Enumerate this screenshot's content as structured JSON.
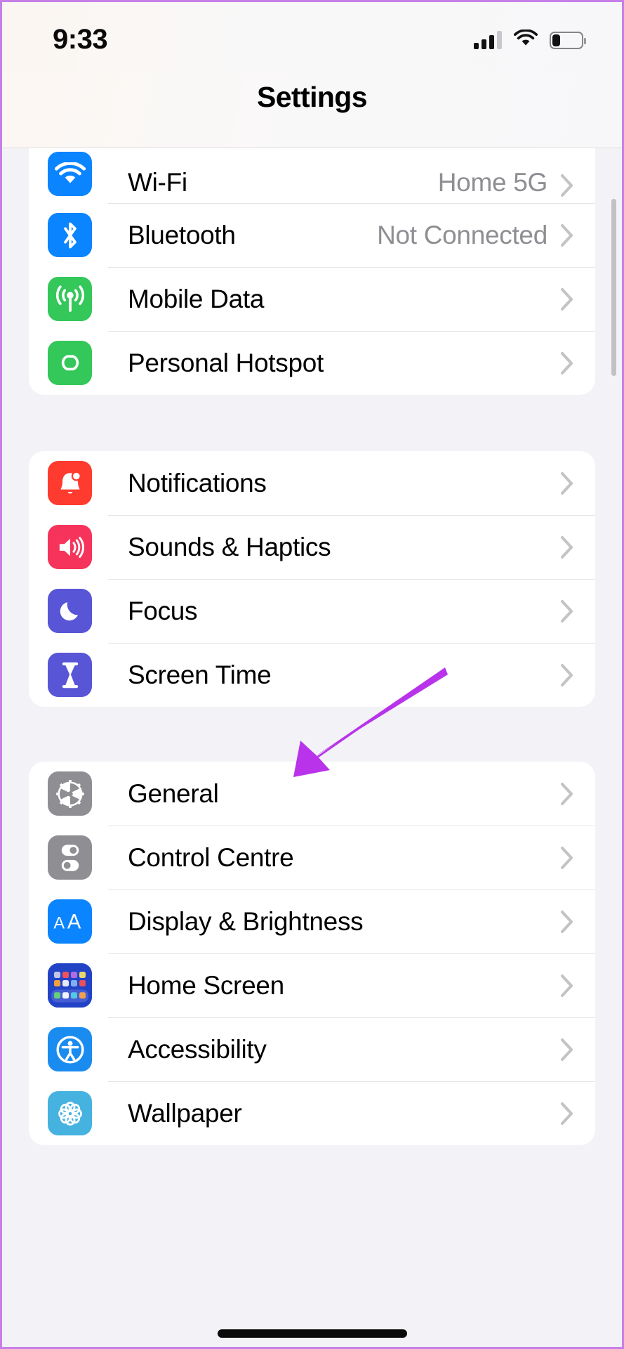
{
  "statusbar": {
    "time": "9:33",
    "cellular_icon": "cellular-signal-icon",
    "cellular_bars_filled": 3,
    "cellular_bars_total": 4,
    "wifi_icon": "wifi-icon",
    "battery_icon": "battery-icon",
    "battery_level_percent": 27
  },
  "navbar": {
    "title": "Settings"
  },
  "accent_colors": {
    "annotation_arrow": "#b833ea",
    "device_border": "#c77fe8",
    "value_text": "#8e8e93",
    "chevron": "#c4c4c6",
    "page_background": "#f2f2f7",
    "card_background": "#ffffff"
  },
  "annotation": {
    "arrow_name": "screen-time-pointer-arrow",
    "points_at": "Screen Time"
  },
  "groups": [
    {
      "name": "connectivity",
      "rows": [
        {
          "label": "Wi-Fi",
          "value": "Home 5G",
          "icon": "wifi-icon",
          "icon_bg": "#0a84ff"
        },
        {
          "label": "Bluetooth",
          "value": "Not Connected",
          "icon": "bluetooth-icon",
          "icon_bg": "#0a84ff"
        },
        {
          "label": "Mobile Data",
          "value": "",
          "icon": "antenna-icon",
          "icon_bg": "#34c759"
        },
        {
          "label": "Personal Hotspot",
          "value": "",
          "icon": "hotspot-link-icon",
          "icon_bg": "#34c759"
        }
      ]
    },
    {
      "name": "alerts-and-time",
      "rows": [
        {
          "label": "Notifications",
          "value": "",
          "icon": "bell-icon",
          "icon_bg": "#ff3b30"
        },
        {
          "label": "Sounds & Haptics",
          "value": "",
          "icon": "speaker-icon",
          "icon_bg": "#f6335a"
        },
        {
          "label": "Focus",
          "value": "",
          "icon": "moon-icon",
          "icon_bg": "#5856d6"
        },
        {
          "label": "Screen Time",
          "value": "",
          "icon": "hourglass-icon",
          "icon_bg": "#5856d6"
        }
      ]
    },
    {
      "name": "system",
      "rows": [
        {
          "label": "General",
          "value": "",
          "icon": "gear-icon",
          "icon_bg": "#8e8e93"
        },
        {
          "label": "Control Centre",
          "value": "",
          "icon": "toggles-icon",
          "icon_bg": "#8e8e93"
        },
        {
          "label": "Display & Brightness",
          "value": "",
          "icon": "text-size-aa-icon",
          "icon_bg": "#0a84ff"
        },
        {
          "label": "Home Screen",
          "value": "",
          "icon": "app-grid-icon",
          "icon_bg": "#2343c7"
        },
        {
          "label": "Accessibility",
          "value": "",
          "icon": "accessibility-icon",
          "icon_bg": "#1a8cf0"
        },
        {
          "label": "Wallpaper",
          "value": "",
          "icon": "flower-icon",
          "icon_bg": "#45b2e0"
        }
      ]
    }
  ]
}
